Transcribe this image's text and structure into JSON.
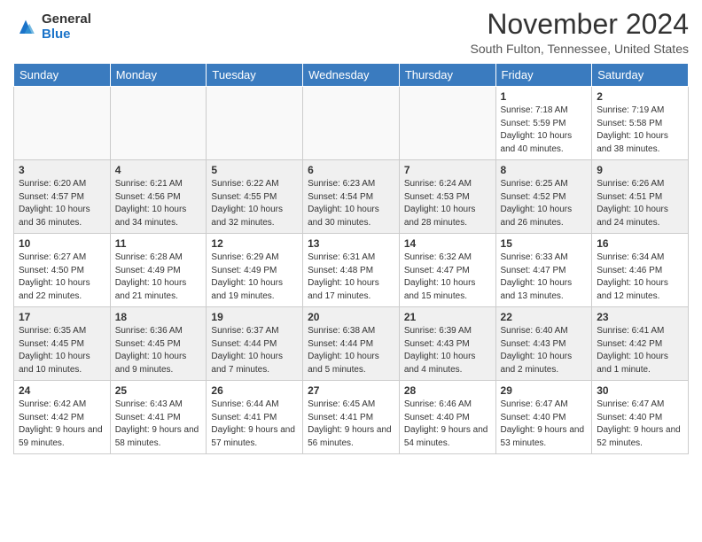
{
  "logo": {
    "general": "General",
    "blue": "Blue"
  },
  "title": "November 2024",
  "subtitle": "South Fulton, Tennessee, United States",
  "weekdays": [
    "Sunday",
    "Monday",
    "Tuesday",
    "Wednesday",
    "Thursday",
    "Friday",
    "Saturday"
  ],
  "weeks": [
    [
      {
        "day": "",
        "info": ""
      },
      {
        "day": "",
        "info": ""
      },
      {
        "day": "",
        "info": ""
      },
      {
        "day": "",
        "info": ""
      },
      {
        "day": "",
        "info": ""
      },
      {
        "day": "1",
        "info": "Sunrise: 7:18 AM\nSunset: 5:59 PM\nDaylight: 10 hours and 40 minutes."
      },
      {
        "day": "2",
        "info": "Sunrise: 7:19 AM\nSunset: 5:58 PM\nDaylight: 10 hours and 38 minutes."
      }
    ],
    [
      {
        "day": "3",
        "info": "Sunrise: 6:20 AM\nSunset: 4:57 PM\nDaylight: 10 hours and 36 minutes."
      },
      {
        "day": "4",
        "info": "Sunrise: 6:21 AM\nSunset: 4:56 PM\nDaylight: 10 hours and 34 minutes."
      },
      {
        "day": "5",
        "info": "Sunrise: 6:22 AM\nSunset: 4:55 PM\nDaylight: 10 hours and 32 minutes."
      },
      {
        "day": "6",
        "info": "Sunrise: 6:23 AM\nSunset: 4:54 PM\nDaylight: 10 hours and 30 minutes."
      },
      {
        "day": "7",
        "info": "Sunrise: 6:24 AM\nSunset: 4:53 PM\nDaylight: 10 hours and 28 minutes."
      },
      {
        "day": "8",
        "info": "Sunrise: 6:25 AM\nSunset: 4:52 PM\nDaylight: 10 hours and 26 minutes."
      },
      {
        "day": "9",
        "info": "Sunrise: 6:26 AM\nSunset: 4:51 PM\nDaylight: 10 hours and 24 minutes."
      }
    ],
    [
      {
        "day": "10",
        "info": "Sunrise: 6:27 AM\nSunset: 4:50 PM\nDaylight: 10 hours and 22 minutes."
      },
      {
        "day": "11",
        "info": "Sunrise: 6:28 AM\nSunset: 4:49 PM\nDaylight: 10 hours and 21 minutes."
      },
      {
        "day": "12",
        "info": "Sunrise: 6:29 AM\nSunset: 4:49 PM\nDaylight: 10 hours and 19 minutes."
      },
      {
        "day": "13",
        "info": "Sunrise: 6:31 AM\nSunset: 4:48 PM\nDaylight: 10 hours and 17 minutes."
      },
      {
        "day": "14",
        "info": "Sunrise: 6:32 AM\nSunset: 4:47 PM\nDaylight: 10 hours and 15 minutes."
      },
      {
        "day": "15",
        "info": "Sunrise: 6:33 AM\nSunset: 4:47 PM\nDaylight: 10 hours and 13 minutes."
      },
      {
        "day": "16",
        "info": "Sunrise: 6:34 AM\nSunset: 4:46 PM\nDaylight: 10 hours and 12 minutes."
      }
    ],
    [
      {
        "day": "17",
        "info": "Sunrise: 6:35 AM\nSunset: 4:45 PM\nDaylight: 10 hours and 10 minutes."
      },
      {
        "day": "18",
        "info": "Sunrise: 6:36 AM\nSunset: 4:45 PM\nDaylight: 10 hours and 9 minutes."
      },
      {
        "day": "19",
        "info": "Sunrise: 6:37 AM\nSunset: 4:44 PM\nDaylight: 10 hours and 7 minutes."
      },
      {
        "day": "20",
        "info": "Sunrise: 6:38 AM\nSunset: 4:44 PM\nDaylight: 10 hours and 5 minutes."
      },
      {
        "day": "21",
        "info": "Sunrise: 6:39 AM\nSunset: 4:43 PM\nDaylight: 10 hours and 4 minutes."
      },
      {
        "day": "22",
        "info": "Sunrise: 6:40 AM\nSunset: 4:43 PM\nDaylight: 10 hours and 2 minutes."
      },
      {
        "day": "23",
        "info": "Sunrise: 6:41 AM\nSunset: 4:42 PM\nDaylight: 10 hours and 1 minute."
      }
    ],
    [
      {
        "day": "24",
        "info": "Sunrise: 6:42 AM\nSunset: 4:42 PM\nDaylight: 9 hours and 59 minutes."
      },
      {
        "day": "25",
        "info": "Sunrise: 6:43 AM\nSunset: 4:41 PM\nDaylight: 9 hours and 58 minutes."
      },
      {
        "day": "26",
        "info": "Sunrise: 6:44 AM\nSunset: 4:41 PM\nDaylight: 9 hours and 57 minutes."
      },
      {
        "day": "27",
        "info": "Sunrise: 6:45 AM\nSunset: 4:41 PM\nDaylight: 9 hours and 56 minutes."
      },
      {
        "day": "28",
        "info": "Sunrise: 6:46 AM\nSunset: 4:40 PM\nDaylight: 9 hours and 54 minutes."
      },
      {
        "day": "29",
        "info": "Sunrise: 6:47 AM\nSunset: 4:40 PM\nDaylight: 9 hours and 53 minutes."
      },
      {
        "day": "30",
        "info": "Sunrise: 6:47 AM\nSunset: 4:40 PM\nDaylight: 9 hours and 52 minutes."
      }
    ]
  ]
}
